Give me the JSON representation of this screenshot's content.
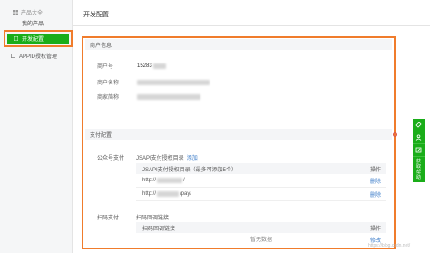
{
  "sidebar": {
    "group_label": "产品大全",
    "my_products": "我的产品",
    "active_item": "开发配置",
    "appid_item": "APPID授权管理"
  },
  "header": {
    "title": "开发配置"
  },
  "merchant_info": {
    "section_title": "商户信息",
    "rows": [
      {
        "label": "商户号",
        "value": "15283"
      },
      {
        "label": "商户名称",
        "value": ""
      },
      {
        "label": "商家简称",
        "value": ""
      }
    ]
  },
  "pay_config": {
    "section_title": "支付配置",
    "official_account": {
      "label": "公众号支付",
      "dir_label": "JSAPI支付授权目录",
      "add_link": "添加",
      "table_header": "JSAPI支付授权目录（最多可添加5个）",
      "op_header": "操作",
      "rows": [
        {
          "url_prefix": "http://",
          "url_suffix": "/",
          "op": "删除"
        },
        {
          "url_prefix": "http://",
          "url_suffix": "/pay/",
          "op": "删除"
        }
      ]
    },
    "native": {
      "label": "扫码支付",
      "callback_label": "扫码回调链接",
      "table_header": "扫码回调链接",
      "op_header": "操作",
      "empty_text": "暂无数据",
      "edit_label": "修改"
    }
  },
  "right_toolbar": {
    "feedback_text": "获取帮助"
  },
  "watermark": "https://blog.csdn.net/",
  "colors": {
    "brand_green": "#1aad19",
    "highlight_orange": "#f07c2c",
    "link_blue": "#3d7dc9"
  }
}
